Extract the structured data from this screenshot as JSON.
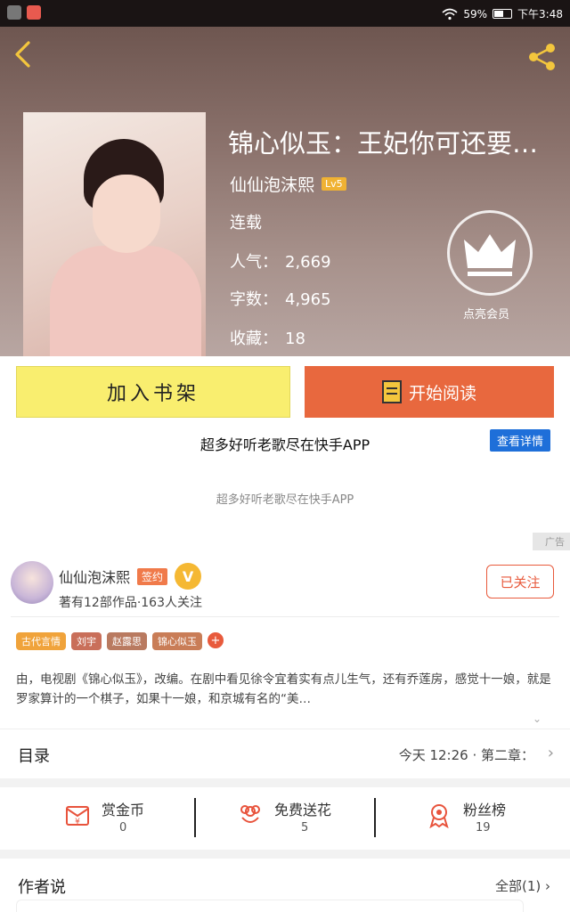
{
  "status_bar": {
    "battery": "59%",
    "time": "下午3:48"
  },
  "book": {
    "title": "锦心似玉：王妃你可还要…",
    "author": "仙仙泡沫熙",
    "level": "Lv5",
    "status": "连载",
    "popularity_label": "人气：",
    "popularity": "2,669",
    "words_label": "字数：",
    "words": "4,965",
    "favorites_label": "收藏：",
    "favorites": "18"
  },
  "vip": {
    "label": "点亮会员"
  },
  "actions": {
    "add_shelf": "加入书架",
    "start_read": "开始阅读"
  },
  "ad": {
    "title": "超多好听老歌尽在快手APP",
    "detail_button": "查看详情",
    "subtitle": "超多好听老歌尽在快手APP",
    "tag": "广告"
  },
  "author_card": {
    "name": "仙仙泡沫熙",
    "badge": "签约",
    "vmark": "V",
    "stats": "著有12部作品·163人关注",
    "follow_button": "已关注",
    "tags": [
      {
        "label": "古代言情",
        "color": "#f0a33b"
      },
      {
        "label": "刘宇",
        "color": "#c96f5a"
      },
      {
        "label": "赵露思",
        "color": "#b97a60"
      },
      {
        "label": "锦心似玉",
        "color": "#c97d57"
      }
    ],
    "tag_add": "+",
    "synopsis": "由，电视剧《锦心似玉》，改编。在剧中看见徐令宜着实有点儿生气，还有乔莲房，感觉十一娘，就是罗家算计的一个棋子，如果十一娘，和京城有名的“美…"
  },
  "toc": {
    "label": "目录",
    "latest": "今天 12:26 · 第二章："
  },
  "support": {
    "items": [
      {
        "label": "赏金币",
        "count": "0"
      },
      {
        "label": "免费送花",
        "count": "5"
      },
      {
        "label": "粉丝榜",
        "count": "19"
      }
    ]
  },
  "author_say": {
    "label": "作者说",
    "all": "全部(1)"
  },
  "colors": {
    "accent": "#e8683e",
    "shelf": "#f9ee6f",
    "ad_blue": "#1e6fd9"
  }
}
